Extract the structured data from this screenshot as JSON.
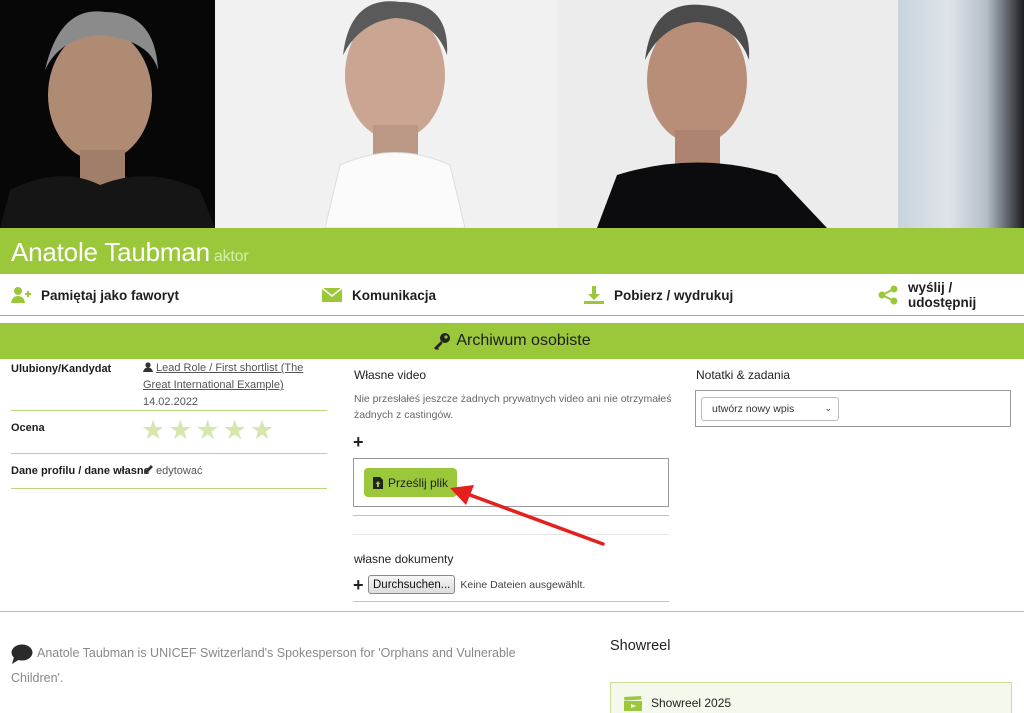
{
  "profile": {
    "name": "Anatole Taubman",
    "role": "aktor"
  },
  "actions": [
    {
      "label": "Pamiętaj jako faworyt",
      "icon": "add-user-icon"
    },
    {
      "label": "Komunikacja",
      "icon": "envelope-icon"
    },
    {
      "label": "Pobierz / wydrukuj",
      "icon": "download-icon"
    },
    {
      "label": "wyślij / udostępnij",
      "icon": "share-icon"
    }
  ],
  "archive": {
    "title": "Archiwum osobiste"
  },
  "left": {
    "favorite_label": "Ulubiony/Kandydat",
    "favorite_link": "Lead Role / First shortlist (The Great International Example)",
    "favorite_date": "14.02.2022",
    "rating_label": "Ocena",
    "rating_stars": 0,
    "rating_max": 5,
    "profile_label": "Dane profilu / dane własne",
    "edit_label": "edytować"
  },
  "middle": {
    "video_heading": "Własne video",
    "video_text": "Nie przesłałeś jeszcze żadnych prywatnych video ani nie otrzymałeś żadnych z castingów.",
    "upload_label": "Prześlij plik",
    "docs_heading": "własne dokumenty",
    "browse_label": "Durchsuchen...",
    "no_file_text": "Keine Dateien ausgewählt."
  },
  "right": {
    "notes_heading": "Notatki & zadania",
    "select_value": "utwórz nowy wpis"
  },
  "bio": {
    "text": "Anatole Taubman is UNICEF Switzerland's Spokesperson for 'Orphans and Vulnerable Children'."
  },
  "showreel": {
    "heading": "Showreel",
    "item": "Showreel 2025"
  },
  "colors": {
    "accent": "#9bc83b",
    "annotation": "#e3201b"
  }
}
